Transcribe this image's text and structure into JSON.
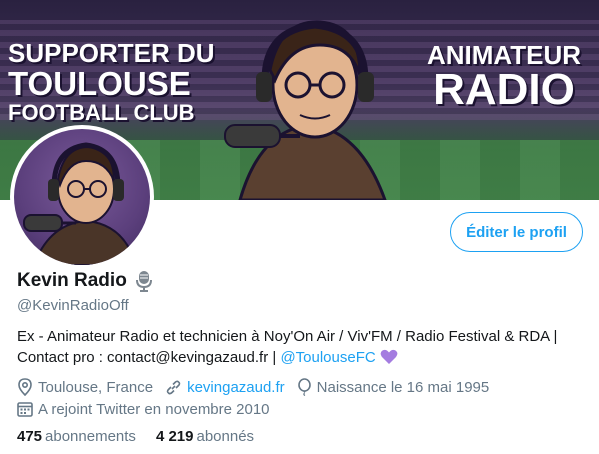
{
  "banner": {
    "left_line1": "SUPPORTER DU",
    "left_line2": "TOULOUSE",
    "left_line3": "FOOTBALL CLUB",
    "right_line1": "ANIMATEUR",
    "right_line2": "RADIO"
  },
  "profile": {
    "display_name": "Kevin Radio",
    "handle": "@KevinRadioOff",
    "edit_button": "Éditer le profil",
    "bio_text": "Ex - Animateur Radio et technicien à Noy'On Air / Viv'FM / Radio Festival & RDA | Contact pro : contact@kevingazaud.fr | ",
    "bio_mention": "@ToulouseFC",
    "location": "Toulouse, France",
    "website": "kevingazaud.fr",
    "birthday": "Naissance le 16 mai 1995",
    "joined": "A rejoint Twitter en novembre 2010"
  },
  "stats": {
    "following_count": "475",
    "following_label": "abonnements",
    "followers_count": "4 219",
    "followers_label": "abonnés"
  },
  "icons": {
    "name_badge": "microphone-icon",
    "bio_emoji": "purple-heart-icon",
    "location": "location-pin-icon",
    "website": "link-icon",
    "birthday": "balloon-icon",
    "joined": "calendar-icon"
  },
  "colors": {
    "accent": "#1da1f2",
    "secondary_text": "#657786",
    "primary_text": "#14171a",
    "heart": "#a47ce0"
  }
}
